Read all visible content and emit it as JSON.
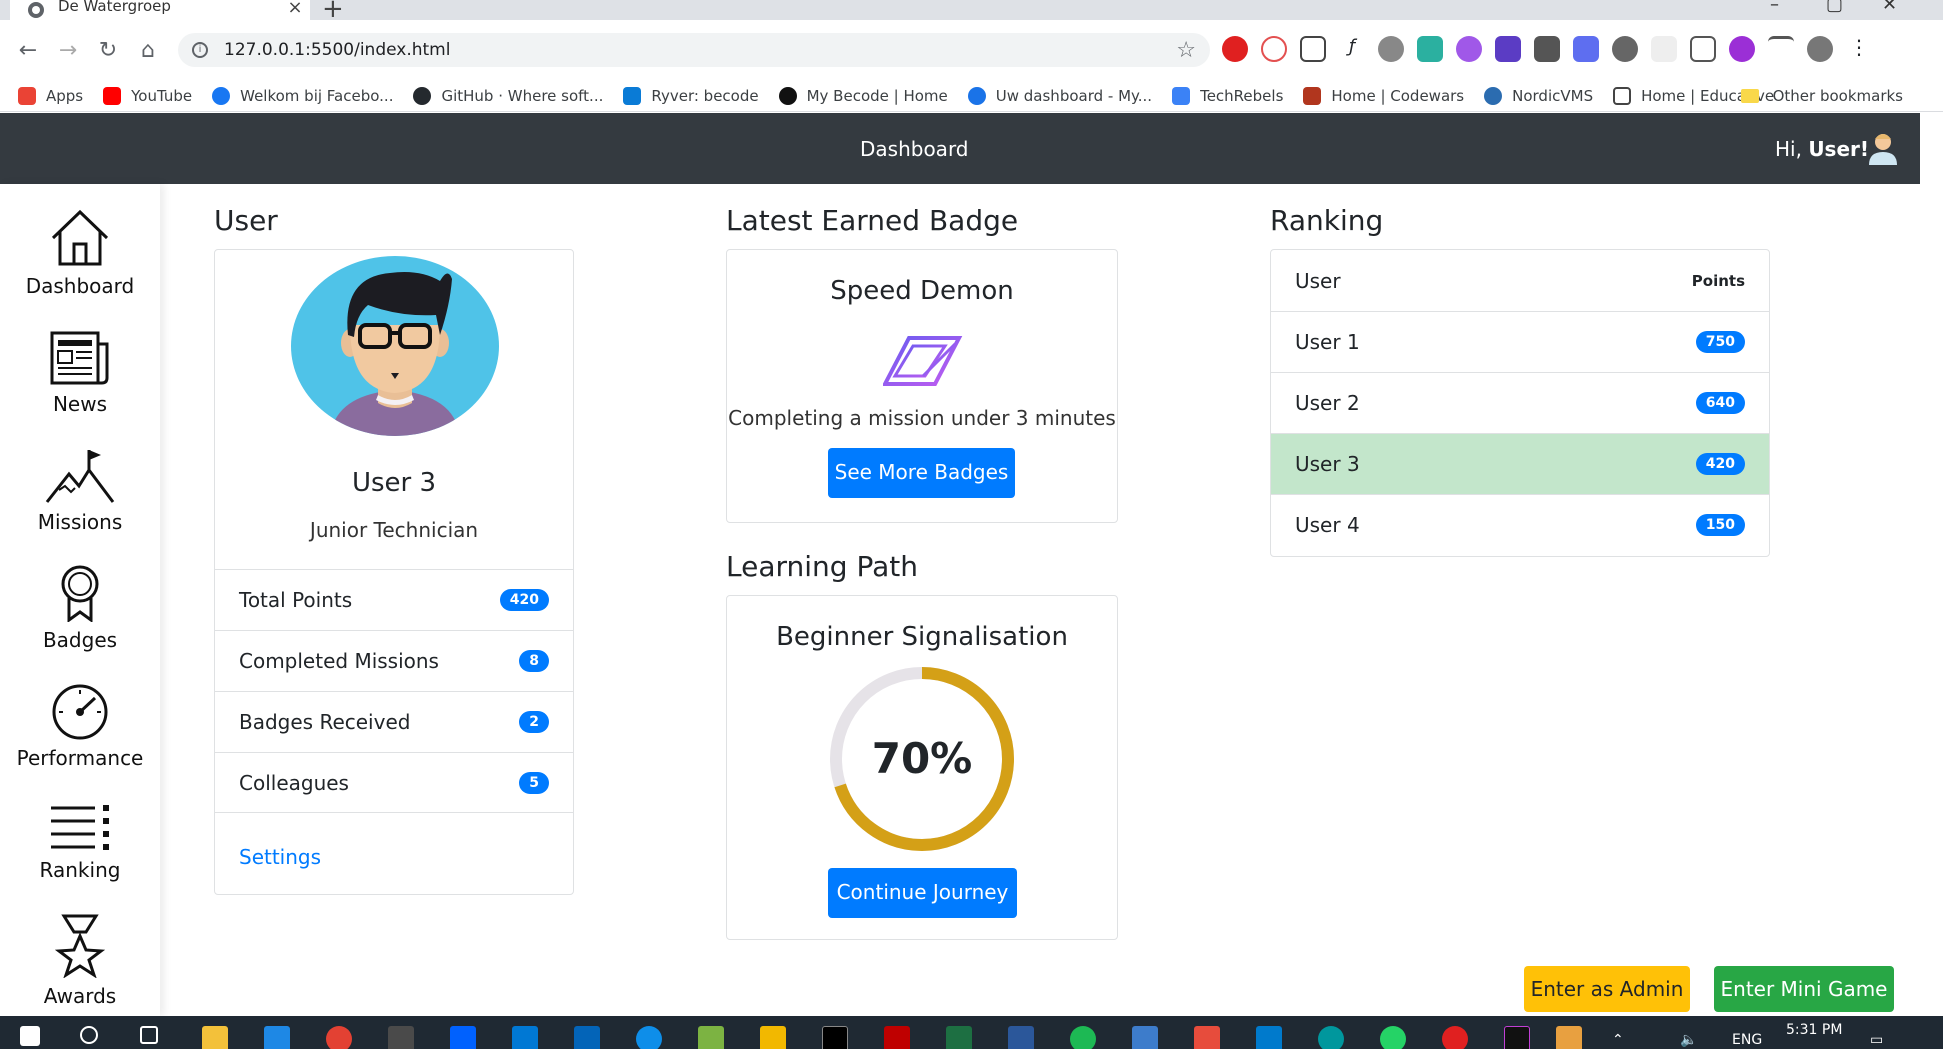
{
  "browser": {
    "tab_title": "De Watergroep",
    "url": "127.0.0.1:5500/index.html",
    "bookmarks": [
      {
        "label": "Apps",
        "color": "#ea4335"
      },
      {
        "label": "YouTube",
        "color": "#ff0000"
      },
      {
        "label": "Welkom bij Facebo...",
        "color": "#1877f2"
      },
      {
        "label": "GitHub · Where soft...",
        "color": "#24292e"
      },
      {
        "label": "Ryver: becode",
        "color": "#0a7bd6"
      },
      {
        "label": "My Becode | Home",
        "color": "#111111"
      },
      {
        "label": "Uw dashboard - My...",
        "color": "#1a73e8"
      },
      {
        "label": "TechRebels",
        "color": "#3b82f6"
      },
      {
        "label": "Home | Codewars",
        "color": "#b1361e"
      },
      {
        "label": "NordicVMS",
        "color": "#2b6cb0"
      },
      {
        "label": "Home | Educative",
        "color": "#444444"
      }
    ],
    "other_bookmarks": "Other bookmarks"
  },
  "header": {
    "title": "Dashboard",
    "greeting_prefix": "Hi,",
    "greeting_name": "User!"
  },
  "sidebar": {
    "items": [
      {
        "label": "Dashboard",
        "icon": "home-icon"
      },
      {
        "label": "News",
        "icon": "newspaper-icon"
      },
      {
        "label": "Missions",
        "icon": "mountain-flag-icon"
      },
      {
        "label": "Badges",
        "icon": "medal-icon"
      },
      {
        "label": "Performance",
        "icon": "speedometer-icon"
      },
      {
        "label": "Ranking",
        "icon": "list-icon"
      },
      {
        "label": "Awards",
        "icon": "star-trophy-icon"
      }
    ]
  },
  "user_section": {
    "title": "User",
    "name": "User 3",
    "role": "Junior Technician",
    "stats": [
      {
        "label": "Total Points",
        "value": "420"
      },
      {
        "label": "Completed Missions",
        "value": "8"
      },
      {
        "label": "Badges Received",
        "value": "2"
      },
      {
        "label": "Colleagues",
        "value": "5"
      }
    ],
    "settings_label": "Settings"
  },
  "badge_section": {
    "title": "Latest Earned Badge",
    "badge_name": "Speed Demon",
    "description": "Completing a mission under 3 minutes",
    "button_label": "See More Badges"
  },
  "learning_section": {
    "title": "Learning Path",
    "path_name": "Beginner Signalisation",
    "progress": 70,
    "progress_label": "70%",
    "button_label": "Continue Journey",
    "ring_color": "#d4a017",
    "track_color": "#e6e3e8"
  },
  "ranking_section": {
    "title": "Ranking",
    "col_user": "User",
    "col_points": "Points",
    "rows": [
      {
        "user": "User 1",
        "points": "750",
        "active": false
      },
      {
        "user": "User 2",
        "points": "640",
        "active": false
      },
      {
        "user": "User 3",
        "points": "420",
        "active": true
      },
      {
        "user": "User 4",
        "points": "150",
        "active": false
      }
    ]
  },
  "actions": {
    "admin_label": "Enter as Admin",
    "game_label": "Enter Mini Game"
  },
  "taskbar": {
    "language": "ENG",
    "time": "5:31 PM"
  },
  "colors": {
    "primary": "#007bff",
    "header_bg": "#343a40",
    "active_row": "#c3e6cb",
    "admin_btn": "#ffc107",
    "game_btn": "#28a745"
  }
}
